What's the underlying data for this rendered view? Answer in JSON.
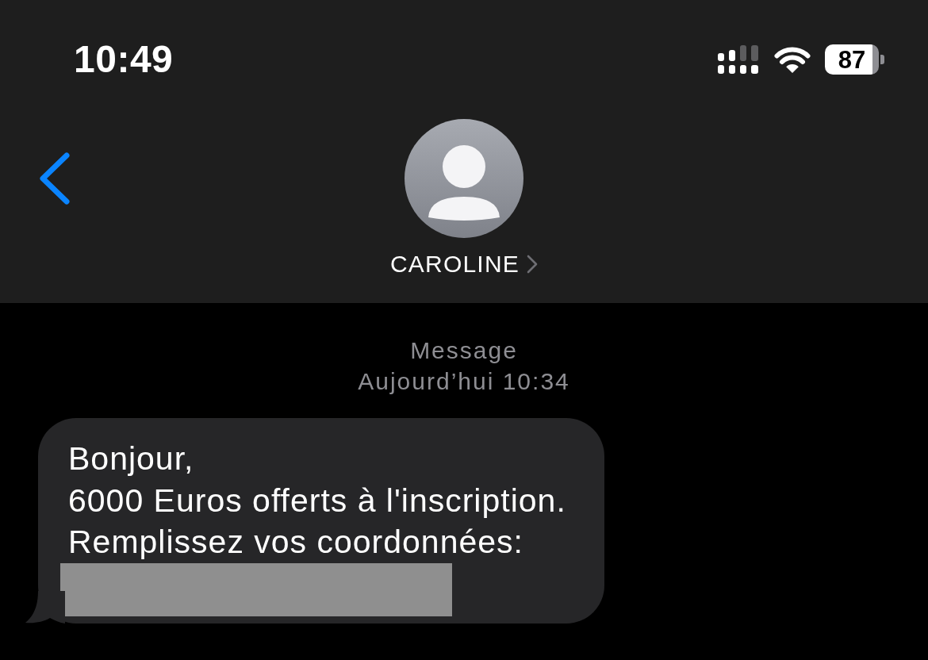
{
  "status_bar": {
    "time": "10:49",
    "battery": "87"
  },
  "header": {
    "contact_name": "CAROLINE"
  },
  "thread": {
    "service_label": "Message",
    "timestamp": "Aujourd’hui 10:34"
  },
  "messages": [
    {
      "kind": "received",
      "text": "Bonjour,\n6000 Euros offerts à l'inscription.\nRemplissez vos coordonnées:",
      "redacted_link": true
    }
  ]
}
